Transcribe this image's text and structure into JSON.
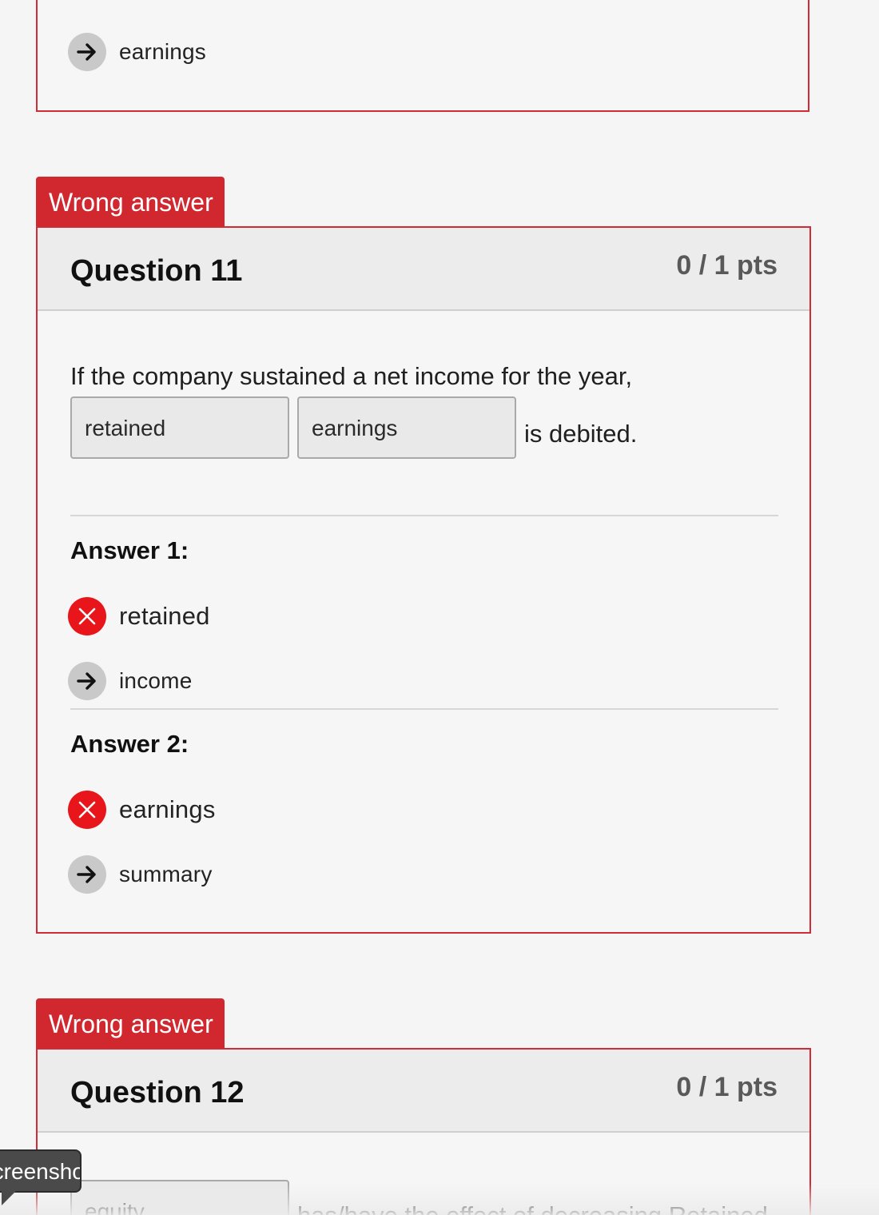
{
  "previous_question": {
    "correct_answer": "earnings"
  },
  "question11": {
    "tab_label": "Wrong answer",
    "title": "Question 11",
    "points": "0 / 1 pts",
    "prompt_line1": "If the company sustained a net income for the year,",
    "blank1_value": "retained",
    "blank2_value": "earnings",
    "prompt_tail": "is debited.",
    "answer1": {
      "label": "Answer 1:",
      "selected": "retained",
      "correct": "income"
    },
    "answer2": {
      "label": "Answer 2:",
      "selected": "earnings",
      "correct": "summary"
    }
  },
  "question12": {
    "tab_label": "Wrong answer",
    "title": "Question 12",
    "points": "0 / 1 pts",
    "blank1_value": "equity",
    "prompt_tail": "has/have the effect of decreasing Retained"
  },
  "screenshot_tooltip": "Screenshot",
  "icons": {
    "arrow": "arrow-right-icon",
    "wrong": "x-icon"
  },
  "colors": {
    "wrong_red": "#d12830",
    "x_badge_red": "#e8161b",
    "arrow_badge_gray": "#c9c9c9"
  }
}
